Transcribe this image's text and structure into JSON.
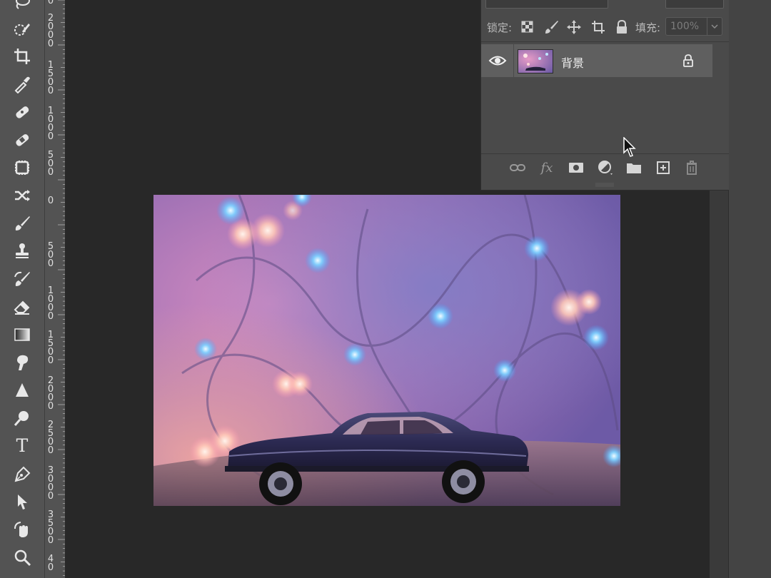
{
  "toolbar": {
    "tools": [
      {
        "name": "lasso-tool",
        "icon": "lasso-icon"
      },
      {
        "name": "quick-selection-tool",
        "icon": "quick-selection-icon"
      },
      {
        "name": "crop-tool",
        "icon": "crop-icon"
      },
      {
        "name": "eyedropper-tool",
        "icon": "eyedropper-icon"
      },
      {
        "name": "spot-healing-tool",
        "icon": "spot-healing-icon"
      },
      {
        "name": "healing-brush-tool",
        "icon": "bandage-icon"
      },
      {
        "name": "patch-tool",
        "icon": "patch-icon"
      },
      {
        "name": "content-aware-move-tool",
        "icon": "content-aware-move-icon"
      },
      {
        "name": "brush-tool",
        "icon": "brush-icon"
      },
      {
        "name": "clone-stamp-tool",
        "icon": "stamp-icon"
      },
      {
        "name": "history-brush-tool",
        "icon": "history-brush-icon"
      },
      {
        "name": "eraser-tool",
        "icon": "eraser-icon"
      },
      {
        "name": "gradient-tool",
        "icon": "gradient-icon"
      },
      {
        "name": "smudge-tool",
        "icon": "smudge-icon"
      },
      {
        "name": "sharpen-tool",
        "icon": "sharpen-icon"
      },
      {
        "name": "dodge-tool",
        "icon": "dodge-icon"
      },
      {
        "name": "type-tool",
        "icon": "type-icon",
        "label": "T"
      },
      {
        "name": "pen-tool",
        "icon": "pen-icon"
      },
      {
        "name": "path-selection-tool",
        "icon": "arrow-icon"
      },
      {
        "name": "rotate-view-tool",
        "icon": "rotate-view-icon"
      },
      {
        "name": "zoom-tool",
        "icon": "zoom-icon"
      }
    ]
  },
  "ruler": {
    "labels": [
      {
        "text": "0"
      },
      {
        "text": "2000"
      },
      {
        "text": "1500"
      },
      {
        "text": "1000"
      },
      {
        "text": "500"
      },
      {
        "text": "0"
      },
      {
        "text": "500"
      },
      {
        "text": "1000"
      },
      {
        "text": "1500"
      },
      {
        "text": "2000"
      },
      {
        "text": "2500"
      },
      {
        "text": "3000"
      },
      {
        "text": "3500"
      },
      {
        "text": "40"
      }
    ]
  },
  "layers_panel": {
    "lock_label": "锁定:",
    "lock_icons": [
      "lock-transparent-pixels-icon",
      "lock-image-pixels-icon",
      "lock-position-icon",
      "lock-artboard-icon",
      "lock-all-icon"
    ],
    "fill_label": "填充:",
    "fill_value": "100%",
    "layers": [
      {
        "name": "背景",
        "visible": true,
        "locked": true
      }
    ],
    "footer_icons": [
      "link-layers-icon",
      "fx-icon",
      "add-mask-icon",
      "adjustment-layer-icon",
      "new-group-icon",
      "new-layer-icon",
      "delete-layer-icon"
    ],
    "fx_label": "fx"
  },
  "document": {
    "subject": "toy car with bokeh lights photo"
  },
  "colors": {
    "toolbar_bg": "#535353",
    "canvas_bg": "#282828",
    "panel_bg": "#4a4a4a",
    "selected_layer_bg": "#5f5f5f"
  }
}
